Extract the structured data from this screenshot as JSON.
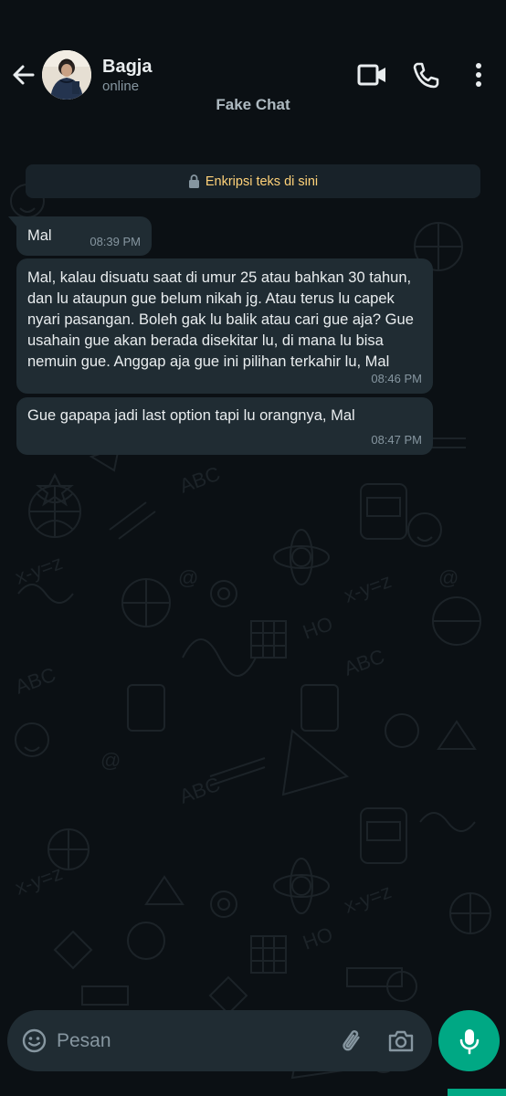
{
  "header": {
    "contact_name": "Bagja",
    "status": "online",
    "subtitle": "Fake Chat"
  },
  "encryption_notice": "Enkripsi teks di sini",
  "messages": [
    {
      "text": "Mal",
      "time": "08:39 PM"
    },
    {
      "text": "Mal, kalau disuatu saat di umur 25 atau bahkan 30 tahun, dan lu ataupun gue belum nikah jg. Atau terus lu capek nyari pasangan. Boleh gak lu balik atau cari gue aja? Gue usahain gue akan berada disekitar lu, di mana lu bisa nemuin gue. Anggap aja gue ini pilihan terkahir lu, Mal",
      "time": "08:46 PM"
    },
    {
      "text": "Gue gapapa jadi last option tapi lu orangnya, Mal",
      "time": "08:47 PM"
    }
  ],
  "composer": {
    "placeholder": "Pesan"
  },
  "icons": [
    "back-arrow-icon",
    "video-call-icon",
    "phone-icon",
    "more-vert-icon",
    "lock-icon",
    "emoji-icon",
    "paperclip-icon",
    "camera-icon",
    "microphone-icon"
  ],
  "colors": {
    "background": "#0b1014",
    "bubble": "#202c33",
    "accent": "#00a884",
    "encryption_text": "#ffd279"
  }
}
